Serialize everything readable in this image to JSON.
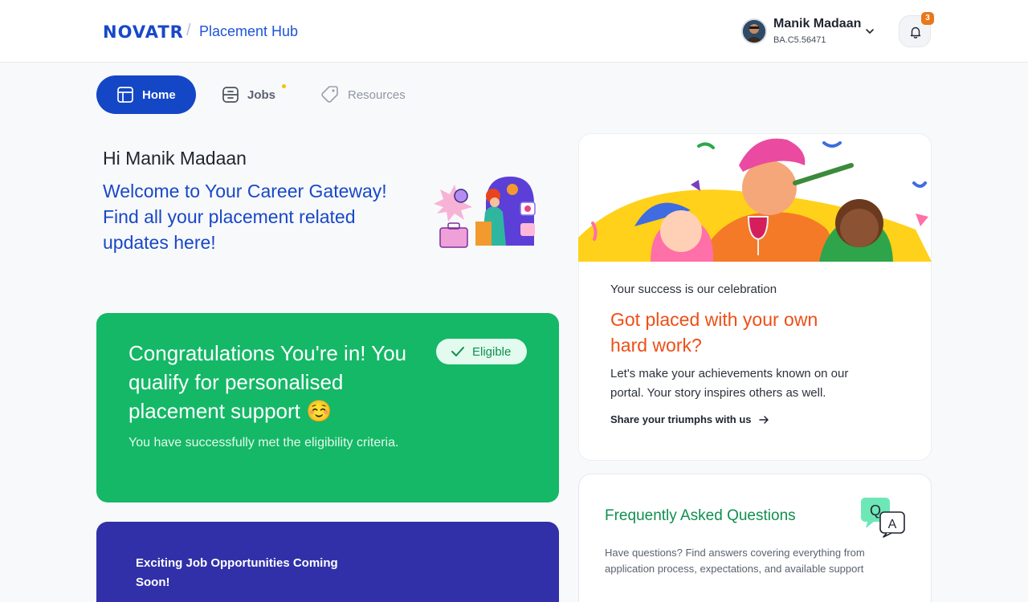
{
  "header": {
    "logo": "NOVATR",
    "separator": "/",
    "product": "Placement Hub",
    "user": {
      "name": "Manik Madaan",
      "id": "BA.C5.56471"
    },
    "notifications": {
      "count": "3"
    }
  },
  "tabs": [
    {
      "label": "Home",
      "icon": "layout-icon",
      "active": true
    },
    {
      "label": "Jobs",
      "icon": "briefcase-icon",
      "has_dot": true
    },
    {
      "label": "Resources",
      "icon": "tag-icon"
    }
  ],
  "greeting": {
    "name": "Hi Manik Madaan",
    "welcome_line1": "Welcome to Your Career Gateway!",
    "welcome_line2": "Find all your placement related updates here!"
  },
  "eligibility_card": {
    "title": "Congratulations You're in! You qualify for personalised placement support ☺️",
    "subtitle": "You have successfully met the eligibility criteria.",
    "badge": "Eligible"
  },
  "jobs_card": {
    "title": "Exciting Job Opportunities Coming Soon!"
  },
  "celebration_card": {
    "kicker": "Your success is our celebration",
    "title": "Got placed with your own hard work?",
    "body": "Let's make your achievements known on our portal. Your story inspires others as well.",
    "link": "Share your triumphs with us"
  },
  "faq_card": {
    "title": "Frequently Asked Questions",
    "body": "Have questions? Find answers covering everything from application process, expectations, and available support"
  },
  "colors": {
    "brand_blue": "#1447c6",
    "success_green": "#14b866",
    "accent_orange": "#ed4f16",
    "indigo": "#3130a8"
  }
}
